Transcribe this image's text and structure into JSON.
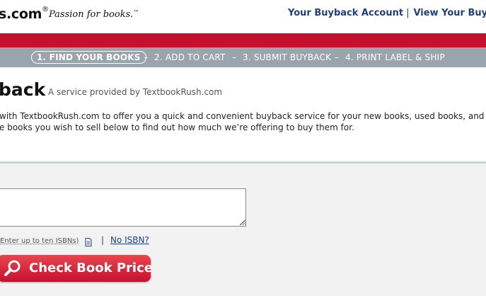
{
  "header": {
    "logo_text": "s.com",
    "logo_reg": "®",
    "tagline": "Passion for books.",
    "tagline_tm": "™",
    "links": {
      "account": "Your Buyback Account",
      "separator": "|",
      "view": "View Your Buyba"
    }
  },
  "steps": [
    {
      "label": "1. FIND YOUR BOOKS",
      "active": true
    },
    {
      "label": "2. ADD TO CART",
      "active": false
    },
    {
      "label": "3. SUBMIT BUYBACK",
      "active": false
    },
    {
      "label": "4. PRINT LABEL & SHIP",
      "active": false
    }
  ],
  "step_separator": "–",
  "intro": {
    "title": "back",
    "service": "A service provided by TextbookRush.com",
    "line1": "with TextbookRush.com to offer you a quick and convenient buyback service for your new books, used books, and",
    "line2": "e books you wish to sell below to find out how much we’re offering to buy them for."
  },
  "form": {
    "isbn_value": "",
    "hint": "Enter up to ten ISBNs)",
    "pipe": "|",
    "no_isbn": "No ISBN?",
    "check_button": "Check Book Price"
  },
  "colors": {
    "brand_red": "#c8102e",
    "link_blue": "#1f3f7a",
    "steps_bar": "#9aa4ad"
  },
  "icons": [
    "magnifier-icon",
    "document-icon",
    "resize-grip-icon"
  ]
}
